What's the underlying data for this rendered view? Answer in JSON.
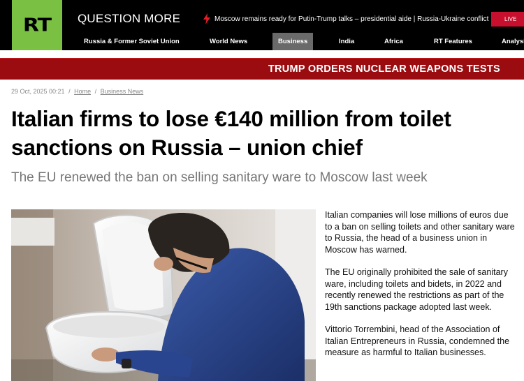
{
  "header": {
    "logo_text": "RT",
    "tagline": "QUESTION MORE",
    "breaking_text": "Moscow remains ready for Putin-Trump talks – presidential aide | Russia-Ukraine conflict",
    "live_label": "LIVE"
  },
  "nav": {
    "items": [
      {
        "label": "Russia & Former Soviet Union"
      },
      {
        "label": "World News"
      },
      {
        "label": "Business"
      },
      {
        "label": "India"
      },
      {
        "label": "Africa"
      },
      {
        "label": "RT Features"
      },
      {
        "label": "Analysis"
      }
    ],
    "active": "Business"
  },
  "banner": {
    "text": "TRUMP ORDERS NUCLEAR WEAPONS TESTS"
  },
  "article": {
    "date": "29 Oct, 2025 00:21",
    "breadcrumb": [
      "Home",
      "Business News"
    ],
    "separator": "/",
    "headline": "Italian firms to lose €140 million from toilet sanctions on Russia – union chief",
    "subtitle": "The EU renewed the ban on selling sanitary ware to Moscow last week",
    "paragraphs": [
      "Italian companies will lose millions of euros due to a ban on selling toilets and other sanitary ware to Russia, the head of a business union in Moscow has warned.",
      "The EU originally prohibited the sale of sanitary ware, including toilets and bidets, in 2022 and recently renewed the restrictions as part of the 19th sanctions package adopted last week.",
      "Vittorio Torrembini, head of the Association of Italian Entrepreneurs in Russia, condemned the measure as harmful to Italian businesses."
    ]
  },
  "colors": {
    "brand_green": "#7ac143",
    "header_bg": "#000000",
    "banner_red": "#9b0c10",
    "live_red": "#c8102e"
  },
  "icons": {
    "breaking": "lightning-bolt-icon"
  }
}
